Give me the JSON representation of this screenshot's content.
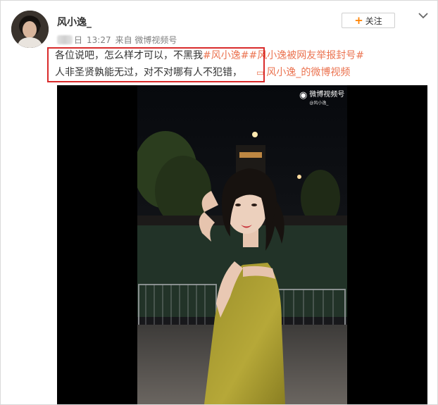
{
  "post": {
    "username": "风小逸_",
    "date_suffix": "日",
    "time": "13:27",
    "source": "来自 微博视频号",
    "follow_label": "关注",
    "follow_icon": "+",
    "text_line1_plain": "各位说吧，怎么样才可以，不黑我",
    "topic1": "#风小逸#",
    "topic2": "#风小逸被网友举报封号#",
    "text_line2_plain": "人非圣贤孰能无过，对不对哪有人不犯错，",
    "video_link_label": "风小逸_的微博视频"
  },
  "video": {
    "watermark_title": "微博视频号",
    "watermark_sub": "@风小逸_"
  },
  "colors": {
    "accent_orange": "#ff8200",
    "topic": "#eb7350",
    "highlight": "#d92b2b"
  }
}
